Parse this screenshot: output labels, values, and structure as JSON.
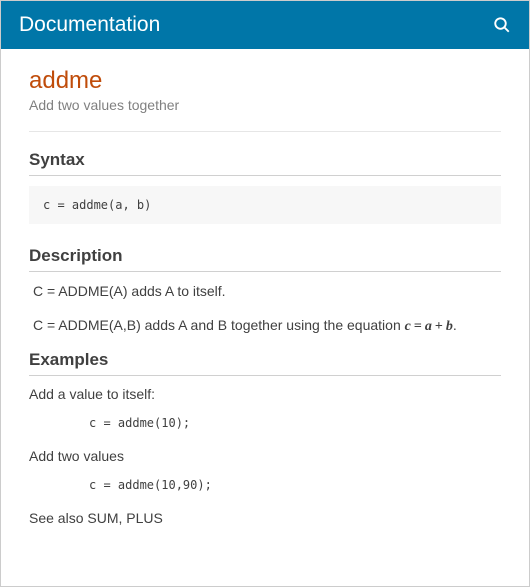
{
  "header": {
    "title": "Documentation",
    "search_icon": "search"
  },
  "page": {
    "title": "addme",
    "subtitle": "Add two values together"
  },
  "syntax": {
    "heading": "Syntax",
    "code": "c = addme(a, b)"
  },
  "description": {
    "heading": "Description",
    "line1_prefix": "C = ADDME(A) adds A to itself.",
    "line2_prefix": "C = ADDME(A,B) adds A and B together using the equation ",
    "equation": {
      "lhs": "c",
      "eq": "=",
      "a": "a",
      "plus": "+",
      "b": "b"
    },
    "line2_suffix": "."
  },
  "examples": {
    "heading": "Examples",
    "intro1": "Add a value to itself:",
    "code1": "c = addme(10);",
    "intro2": "Add two values",
    "code2": "c = addme(10,90);",
    "see_also": "See also SUM, PLUS"
  }
}
